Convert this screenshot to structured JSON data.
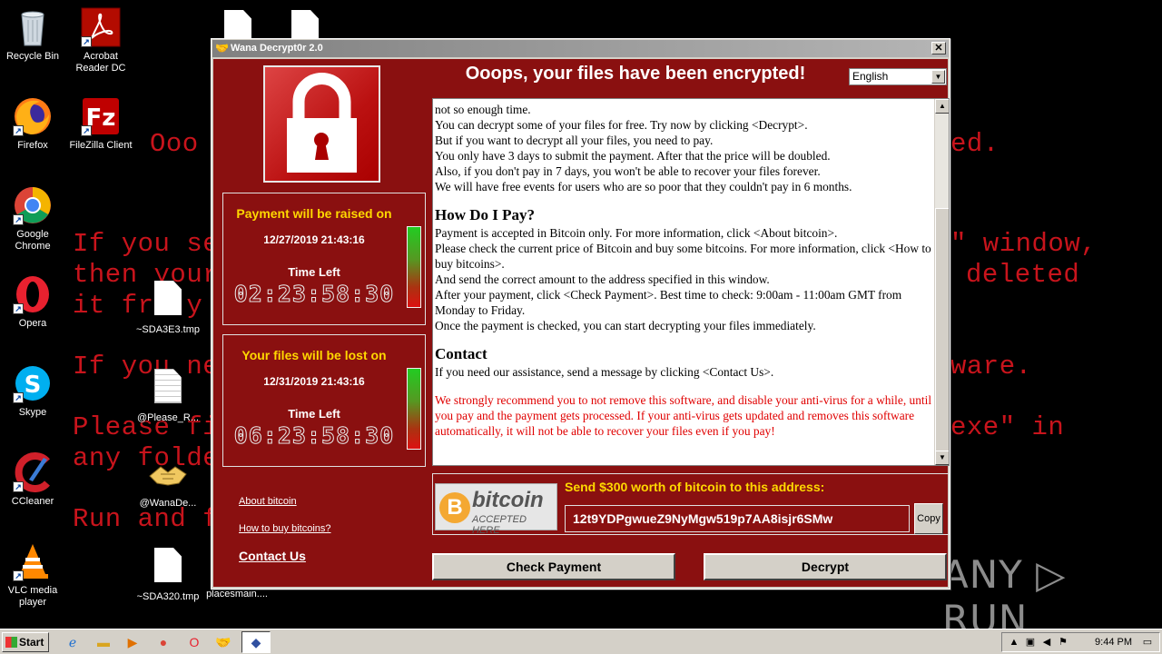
{
  "desktop": {
    "background_lines": [
      {
        "text": "Ooo",
        "left": 0
      },
      {
        "text": "ed.",
        "left": 0
      },
      {
        "text": "If you se",
        "left": 0
      },
      {
        "text": "\" window,",
        "left": 0
      },
      {
        "text": "then your",
        "left": 0
      },
      {
        "text": "deleted",
        "left": 0
      },
      {
        "text": "it fr  y",
        "left": 0
      },
      {
        "text": "If you ne",
        "left": 0
      },
      {
        "text": "ware.",
        "left": 0
      },
      {
        "text": "Please fi",
        "left": 0
      },
      {
        "text": "exe\" in",
        "left": 0
      },
      {
        "text": "any folde",
        "left": 0
      },
      {
        "text": "Run and f",
        "left": 0
      }
    ],
    "icons": [
      {
        "label": "Recycle Bin",
        "icon": "recycle-bin-icon"
      },
      {
        "label": "Acrobat Reader DC",
        "icon": "acrobat-icon"
      },
      {
        "label": "Firefox",
        "icon": "firefox-icon"
      },
      {
        "label": "FileZilla Client",
        "icon": "filezilla-icon"
      },
      {
        "label": "Google Chrome",
        "icon": "chrome-icon"
      },
      {
        "label": "Opera",
        "icon": "opera-icon"
      },
      {
        "label": "Skype",
        "icon": "skype-icon"
      },
      {
        "label": "CCleaner",
        "icon": "ccleaner-icon"
      },
      {
        "label": "VLC media player",
        "icon": "vlc-icon"
      },
      {
        "label": "~SDA3E3.tmp",
        "icon": "file-icon"
      },
      {
        "label": "@Please_R...",
        "icon": "text-file-icon"
      },
      {
        "label": "@WanaDe...",
        "icon": "wanadecryptor-icon"
      },
      {
        "label": "~SDA320.tmp",
        "icon": "file-icon"
      },
      {
        "label": "placesmain....",
        "icon": "file-icon"
      }
    ]
  },
  "window": {
    "title": "Wana Decrypt0r 2.0",
    "headline": "Ooops, your files have been encrypted!",
    "language": "English",
    "timers": [
      {
        "title": "Payment will be raised on",
        "date": "12/27/2019 21:43:16",
        "label": "Time Left",
        "countdown": "02:23:58:30"
      },
      {
        "title": "Your files will be lost on",
        "date": "12/31/2019 21:43:16",
        "label": "Time Left",
        "countdown": "06:23:58:30"
      }
    ],
    "links": {
      "about": "About bitcoin",
      "how_to_buy": "How to buy bitcoins?",
      "contact": "Contact Us"
    },
    "text": {
      "p1": "not so enough time.",
      "p2": "You can decrypt some of your files for free. Try now by clicking <Decrypt>.",
      "p3": "But if you want to decrypt all your files, you need to pay.",
      "p4": "You only have 3 days to submit the payment. After that the price will be doubled.",
      "p5": "Also, if you don't pay in 7 days, you won't be able to recover your files forever.",
      "p6": "We will have free events for users who are so poor that they couldn't pay in 6 months.",
      "h_pay": "How Do I Pay?",
      "pay1": "Payment is accepted in Bitcoin only. For more information, click <About bitcoin>.",
      "pay2": "Please check the current price of Bitcoin and buy some bitcoins. For more information, click <How to buy bitcoins>.",
      "pay3": "And send the correct amount to the address specified in this window.",
      "pay4": "After your payment, click <Check Payment>. Best time to check: 9:00am - 11:00am GMT from Monday to Friday.",
      "pay5": "Once the payment is checked, you can start decrypting your files immediately.",
      "h_contact": "Contact",
      "contact1": "If you need our assistance, send a message by clicking <Contact Us>.",
      "warning": "We strongly recommend you to not remove this software, and disable your anti-virus for a while, until you pay and the payment gets processed. If your anti-virus gets updated and removes this software automatically, it will not be able to recover your files even if you pay!"
    },
    "bitcoin": {
      "logo_word": "bitcoin",
      "logo_sub": "ACCEPTED HERE",
      "send_label": "Send $300 worth of bitcoin to this address:",
      "address": "12t9YDPgwueZ9NyMgw519p7AA8isjr6SMw",
      "copy": "Copy"
    },
    "buttons": {
      "check_payment": "Check Payment",
      "decrypt": "Decrypt"
    }
  },
  "watermark": "ANY ▷ RUN",
  "taskbar": {
    "start": "Start",
    "clock": "9:44 PM"
  },
  "colors": {
    "window_red": "#8a1010",
    "accent_yellow": "#ffd800",
    "bg_text_red": "#c8141c"
  }
}
